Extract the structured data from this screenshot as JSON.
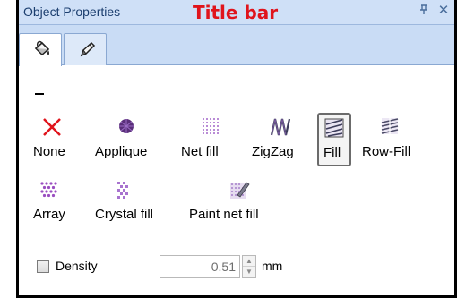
{
  "panel": {
    "title": "Object Properties",
    "annotation": "Title bar",
    "pin_glyph": "ᵖ",
    "close_glyph": "✕"
  },
  "tabs": [
    {
      "icon": "fill-bucket-icon",
      "active": true
    },
    {
      "icon": "pencil-icon",
      "active": false
    }
  ],
  "fill_types": {
    "row1": [
      {
        "label": "None",
        "icon": "red-x-icon"
      },
      {
        "label": "Applique",
        "icon": "applique-icon"
      },
      {
        "label": "Net fill",
        "icon": "net-fill-icon"
      },
      {
        "label": "ZigZag",
        "icon": "zigzag-icon"
      },
      {
        "label": "Fill",
        "icon": "fill-icon",
        "selected": true
      },
      {
        "label": "Row-Fill",
        "icon": "row-fill-icon"
      }
    ],
    "row2": [
      {
        "label": "Array",
        "icon": "array-icon"
      },
      {
        "label": "Crystal fill",
        "icon": "crystal-fill-icon"
      },
      {
        "label": "Paint net fill",
        "icon": "paint-net-fill-icon"
      }
    ]
  },
  "density": {
    "label": "Density",
    "checked": false,
    "value": "0.51",
    "unit": "mm"
  },
  "colors": {
    "title_text": "#1a3d6e",
    "annotation": "#e0141c",
    "titlebar_bg": "#cfe0f7",
    "tabstrip_bg": "#c9dcf5",
    "none_red": "#e0141c",
    "pattern_purple": "#8a3fa8"
  }
}
